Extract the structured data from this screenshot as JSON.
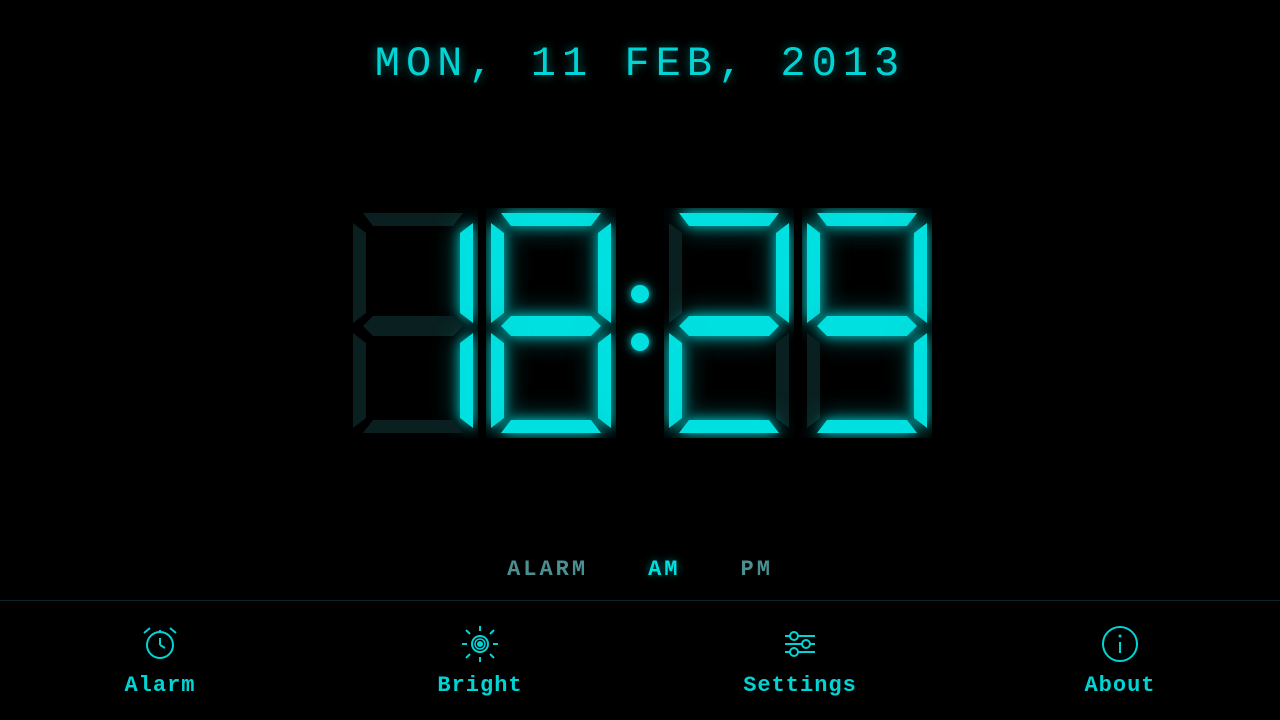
{
  "date": {
    "display": "MON,  11 FEB,  2013"
  },
  "clock": {
    "digits": "18:29",
    "hours": [
      "1",
      "8"
    ],
    "minutes": [
      "2",
      "9"
    ]
  },
  "status": {
    "alarm_label": "ALARM",
    "am_label": "AM",
    "pm_label": "PM",
    "am_active": true
  },
  "nav": {
    "items": [
      {
        "id": "alarm",
        "label": "Alarm",
        "icon": "alarm-clock"
      },
      {
        "id": "bright",
        "label": "Bright",
        "icon": "sun"
      },
      {
        "id": "settings",
        "label": "Settings",
        "icon": "sliders"
      },
      {
        "id": "about",
        "label": "About",
        "icon": "info"
      }
    ]
  },
  "colors": {
    "primary": "#00d4d4",
    "dim": "#4a9090",
    "background": "#000000"
  }
}
